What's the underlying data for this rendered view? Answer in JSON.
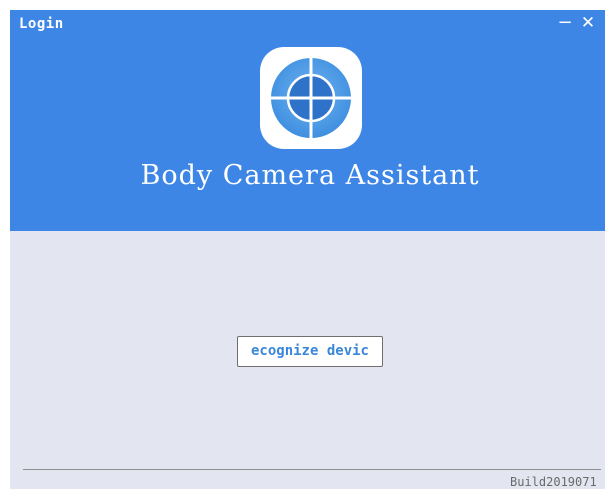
{
  "window": {
    "title": "Login",
    "minimize_glyph": "−",
    "close_glyph": "✕"
  },
  "header": {
    "logo_icon": "crosshair-target-icon",
    "app_name": "Body Camera Assistant"
  },
  "main": {
    "recognize_button_label": "ecognize devic"
  },
  "footer": {
    "build_label": "Build2019071"
  },
  "colors": {
    "header_bg": "#3e86e6",
    "body_bg": "#e3e6f1",
    "button_text": "#3a86d9"
  }
}
